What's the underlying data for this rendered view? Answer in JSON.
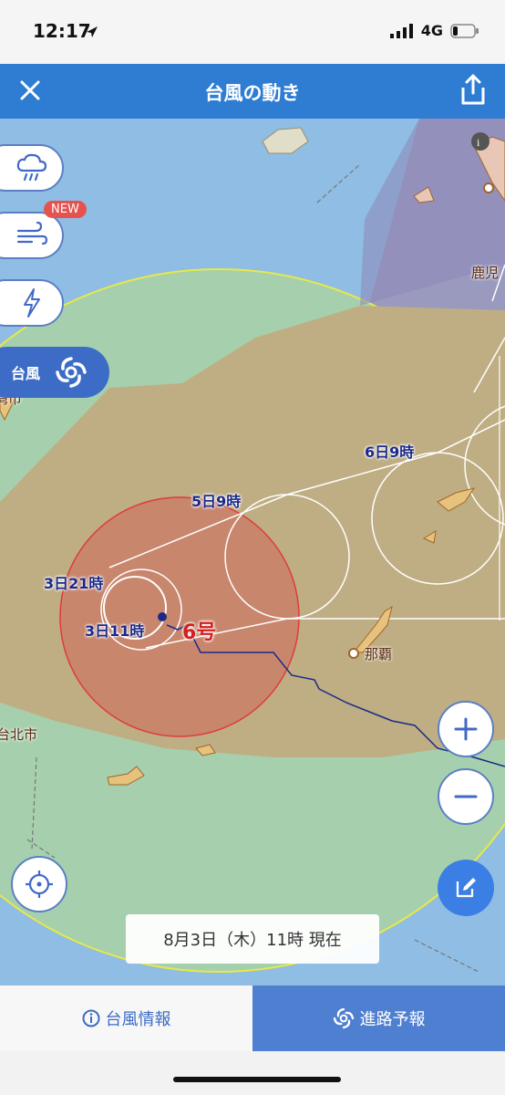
{
  "status": {
    "time": "12:17",
    "network": "4G"
  },
  "nav": {
    "title": "台風の動き"
  },
  "side_menu": {
    "new_badge": "NEW",
    "typhoon_label": "台風"
  },
  "map": {
    "forecast_labels": {
      "t1": "3日11時",
      "t2": "3日21時",
      "t3": "5日9時",
      "t4": "6日9時"
    },
    "typhoon_number": "6号",
    "places": {
      "naha": "那覇",
      "kagoshima": "鹿児",
      "taipei": "台北市",
      "misc": "湾市"
    },
    "colors": {
      "storm_area": "#e06a52",
      "warning_area": "#b9a77a",
      "track": "#1b2a8a"
    }
  },
  "timestamp": "8月3日（木）11時 現在",
  "tabs": {
    "info": "台風情報",
    "route": "進路予報"
  }
}
